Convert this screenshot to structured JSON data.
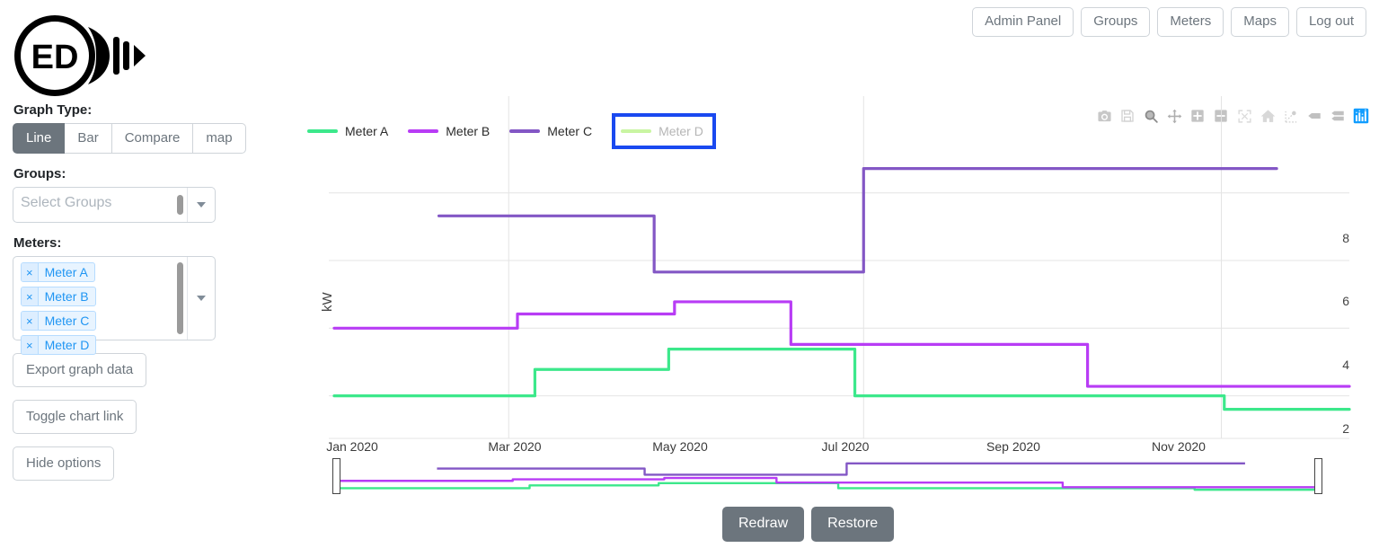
{
  "app": {
    "logo_text": "ED",
    "logo_name": "energy-dashboard-logo"
  },
  "topnav": {
    "items": [
      {
        "label": "Admin Panel",
        "name": "nav-admin-panel"
      },
      {
        "label": "Groups",
        "name": "nav-groups"
      },
      {
        "label": "Meters",
        "name": "nav-meters"
      },
      {
        "label": "Maps",
        "name": "nav-maps"
      },
      {
        "label": "Log out",
        "name": "nav-log-out"
      }
    ]
  },
  "sidebar": {
    "graph_type_label": "Graph Type:",
    "graph_types": [
      {
        "label": "Line",
        "active": true
      },
      {
        "label": "Bar",
        "active": false
      },
      {
        "label": "Compare",
        "active": false
      },
      {
        "label": "map",
        "active": false
      }
    ],
    "groups_label": "Groups:",
    "groups_placeholder": "Select Groups",
    "meters_label": "Meters:",
    "meters_selected": [
      "Meter A",
      "Meter B",
      "Meter C",
      "Meter D"
    ],
    "chip_remove_glyph": "×",
    "buttons": [
      {
        "label": "Export graph data",
        "name": "export-graph-data-button"
      },
      {
        "label": "Toggle chart link",
        "name": "toggle-chart-link-button"
      },
      {
        "label": "Hide options",
        "name": "hide-options-button"
      }
    ]
  },
  "footer": {
    "redraw_label": "Redraw",
    "restore_label": "Restore"
  },
  "modebar": {
    "icons": [
      "camera-icon",
      "save-disk-icon",
      "zoom-box-icon",
      "pan-icon",
      "zoom-in-icon",
      "zoom-out-icon",
      "autoscale-icon",
      "reset-home-icon",
      "spike-lines-icon",
      "hover-closest-icon",
      "hover-compare-icon",
      "plotly-logo-icon"
    ],
    "active_icon": "plotly-logo-icon",
    "active_color": "#119dff"
  },
  "chart_data": {
    "type": "line",
    "title": "",
    "xlabel": "",
    "ylabel": "kW",
    "xtick_labels": [
      "Jan 2020",
      "Mar 2020",
      "May 2020",
      "Jul 2020",
      "Sep 2020",
      "Nov 2020"
    ],
    "ytick_labels": [
      "2",
      "4",
      "6",
      "8"
    ],
    "ylim": [
      0.9,
      9.4
    ],
    "grid": true,
    "legend_position": "top-left",
    "line_shape": "hv-step",
    "legend": [
      {
        "name": "Meter A",
        "color": "#3ce88b",
        "visible": true
      },
      {
        "name": "Meter B",
        "color": "#b83cf5",
        "visible": true
      },
      {
        "name": "Meter C",
        "color": "#8357c5",
        "visible": true
      },
      {
        "name": "Meter D",
        "color": "#c9f5a2",
        "visible": false,
        "focused": true
      }
    ],
    "series": [
      {
        "name": "Meter A",
        "color": "#3ce88b",
        "x": [
          "2020-01-01",
          "2020-03-05",
          "2020-03-10",
          "2020-04-20",
          "2020-04-25",
          "2020-06-22",
          "2020-06-28",
          "2020-10-26",
          "2020-11-02",
          "2020-12-15"
        ],
        "y": [
          2.0,
          2.0,
          2.78,
          2.78,
          3.38,
          3.38,
          2.0,
          2.0,
          1.6,
          1.6
        ]
      },
      {
        "name": "Meter B",
        "color": "#b83cf5",
        "x": [
          "2020-01-01",
          "2020-02-28",
          "2020-03-04",
          "2020-04-22",
          "2020-04-27",
          "2020-05-31",
          "2020-06-06",
          "2020-09-10",
          "2020-09-16",
          "2020-12-15"
        ],
        "y": [
          4.0,
          4.0,
          4.42,
          4.42,
          4.78,
          4.78,
          3.52,
          3.52,
          2.28,
          2.28
        ]
      },
      {
        "name": "Meter C",
        "color": "#8357c5",
        "x": [
          "2020-02-06",
          "2020-04-15",
          "2020-04-20",
          "2020-06-26",
          "2020-07-01",
          "2020-11-20"
        ],
        "y": [
          7.32,
          7.32,
          5.66,
          5.66,
          8.72,
          8.72
        ]
      }
    ],
    "rangeslider": {
      "visible": true,
      "start": 0.0,
      "end": 1.0
    }
  }
}
